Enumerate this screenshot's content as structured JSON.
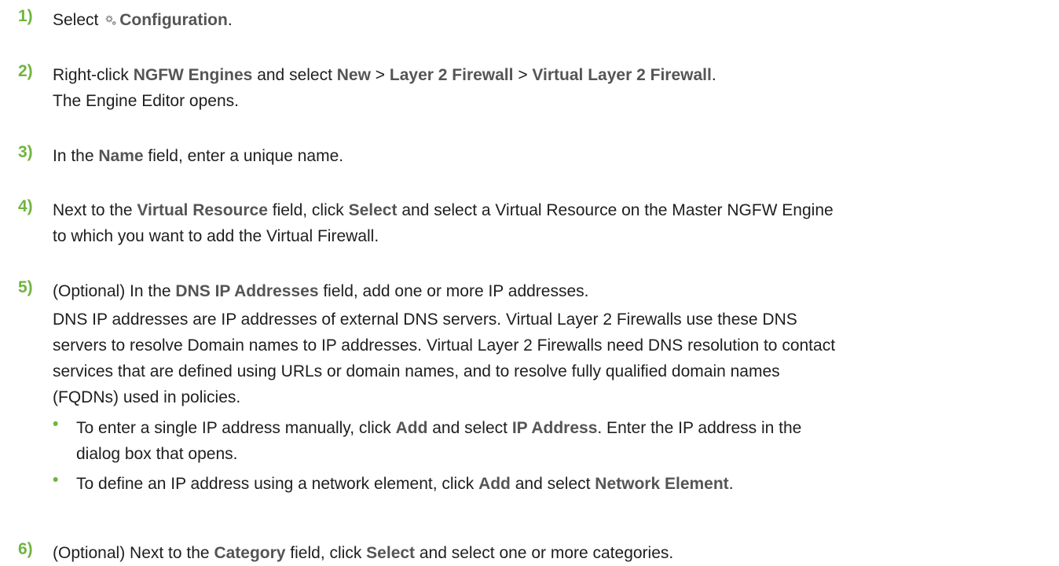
{
  "steps": [
    {
      "num": "1)",
      "parts": {
        "a": "Select ",
        "b": "Configuration",
        "c": "."
      }
    },
    {
      "num": "2)",
      "parts": {
        "a": "Right-click ",
        "b": "NGFW Engines",
        "c": " and select ",
        "d": "New",
        "e": " > ",
        "f": "Layer 2 Firewall",
        "g": " > ",
        "h": "Virtual Layer 2 Firewall",
        "i": "."
      },
      "note": "The Engine Editor opens."
    },
    {
      "num": "3)",
      "parts": {
        "a": "In the ",
        "b": "Name",
        "c": " field, enter a unique name."
      }
    },
    {
      "num": "4)",
      "parts": {
        "a": "Next to the ",
        "b": "Virtual Resource",
        "c": " field, click ",
        "d": "Select",
        "e": " and select a Virtual Resource on the Master NGFW Engine",
        "f": "to which you want to add the Virtual Firewall."
      }
    },
    {
      "num": "5)",
      "parts": {
        "a": "(Optional) In the ",
        "b": "DNS IP Addresses",
        "c": " field, add one or more IP addresses."
      },
      "desc": {
        "l1": "DNS IP addresses are IP addresses of external DNS servers. Virtual Layer 2 Firewalls use these DNS",
        "l2": "servers to resolve Domain names to IP addresses. Virtual Layer 2 Firewalls need DNS resolution to contact",
        "l3": "services that are defined using URLs or domain names, and to resolve fully qualified domain names",
        "l4": "(FQDNs) used in policies."
      },
      "bullets": [
        {
          "a": "To enter a single IP address manually, click ",
          "b": "Add",
          "c": " and select ",
          "d": "IP Address",
          "e": ". Enter the IP address in the",
          "f": "dialog box that opens."
        },
        {
          "a": "To define an IP address using a network element, click ",
          "b": "Add",
          "c": " and select ",
          "d": "Network Element",
          "e": "."
        }
      ]
    },
    {
      "num": "6)",
      "parts": {
        "a": "(Optional) Next to the ",
        "b": "Category",
        "c": " field, click ",
        "d": "Select",
        "e": " and select one or more categories."
      }
    }
  ],
  "icons": {
    "configuration": "gear-icon"
  },
  "colors": {
    "step_number": "#6fb53f",
    "bold_term": "#555555",
    "text": "#1e1e1e"
  }
}
